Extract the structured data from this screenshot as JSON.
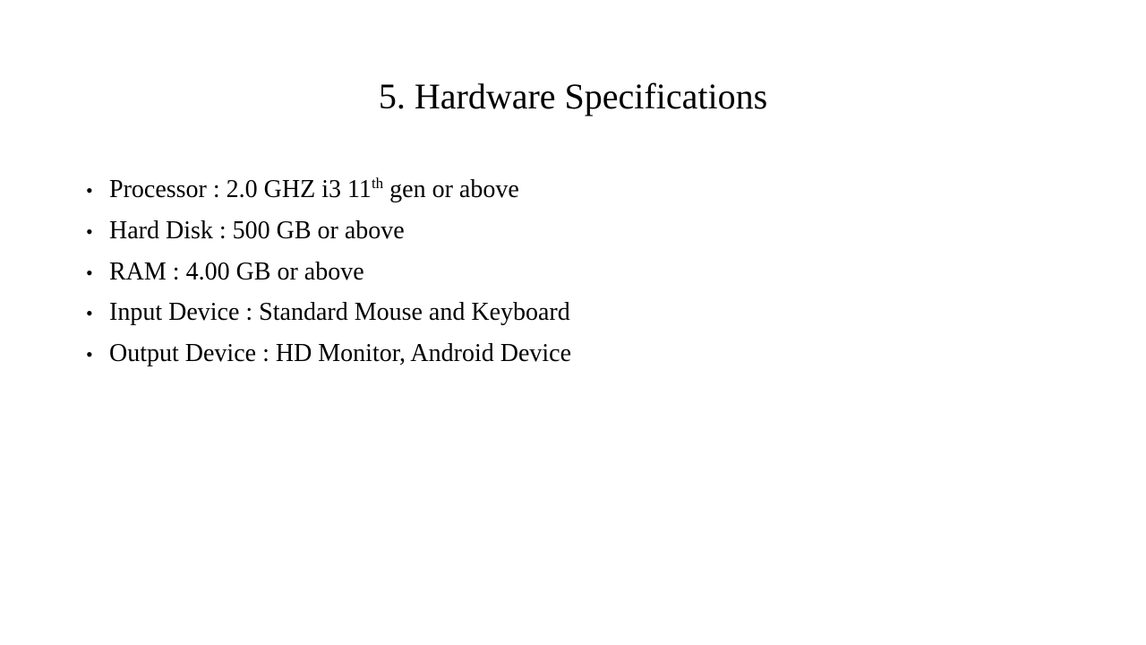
{
  "slide": {
    "title": "5. Hardware Specifications",
    "bullet_glyph": "•",
    "items": [
      {
        "pre": "Processor : 2.0 GHZ i3 11",
        "sup": "th",
        "post": " gen or above"
      },
      {
        "pre": "Hard Disk : 500 GB or above",
        "sup": "",
        "post": ""
      },
      {
        "pre": "RAM : 4.00 GB or above",
        "sup": "",
        "post": ""
      },
      {
        "pre": "Input Device : Standard Mouse and Keyboard",
        "sup": "",
        "post": ""
      },
      {
        "pre": "Output Device : HD Monitor, Android Device",
        "sup": "",
        "post": ""
      }
    ]
  }
}
